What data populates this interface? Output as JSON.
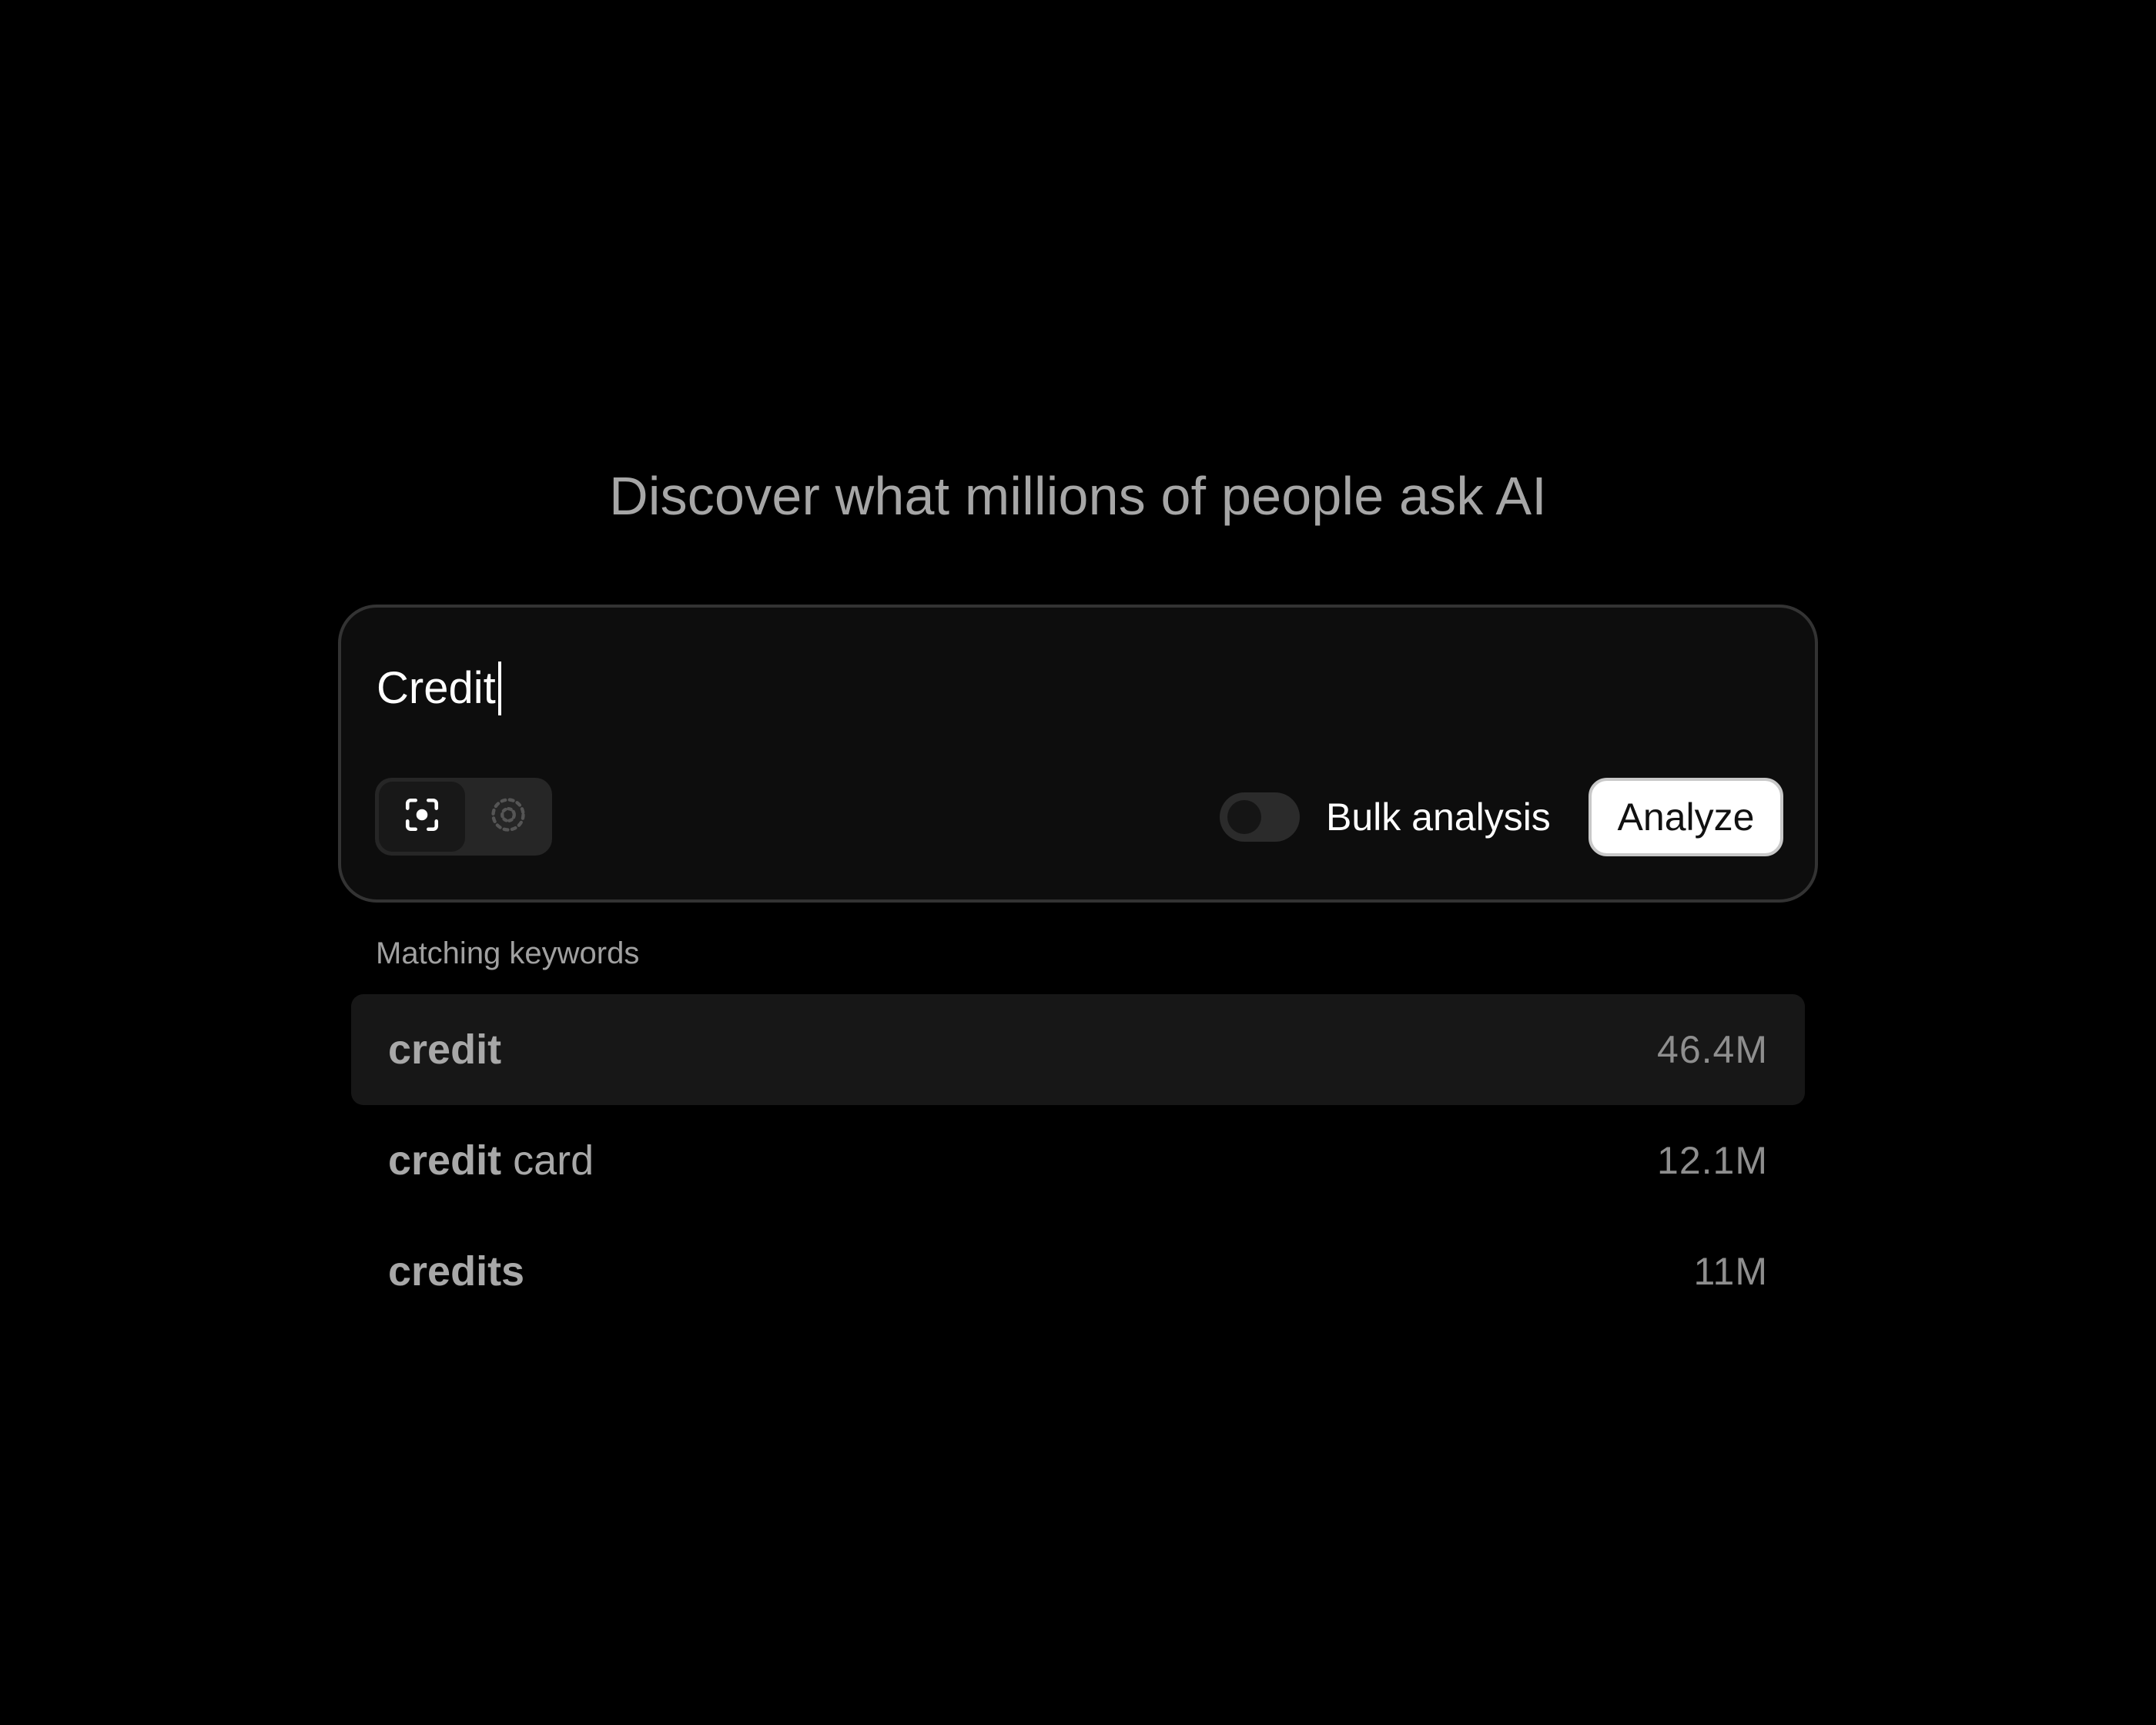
{
  "headline": "Discover what millions of people ask AI",
  "search": {
    "query": "Credit",
    "modes": [
      {
        "icon": "focus-scan-icon",
        "active": true
      },
      {
        "icon": "dotted-scan-icon",
        "active": false
      }
    ],
    "bulk_toggle": {
      "label": "Bulk analysis",
      "enabled": false
    },
    "analyze_label": "Analyze"
  },
  "keywords": {
    "label": "Matching keywords",
    "items": [
      {
        "match": "credit",
        "rest": "",
        "count": "46.4M",
        "highlighted": true
      },
      {
        "match": "credit",
        "rest": " card",
        "count": "12.1M",
        "highlighted": false
      },
      {
        "match": "credits",
        "rest": "",
        "count": "11M",
        "highlighted": false
      }
    ]
  },
  "colors": {
    "background": "#000000",
    "card": "#0d0d0d",
    "card_border": "#333333",
    "accent_button": "#ffffff",
    "muted_text": "#a6a6a6"
  }
}
